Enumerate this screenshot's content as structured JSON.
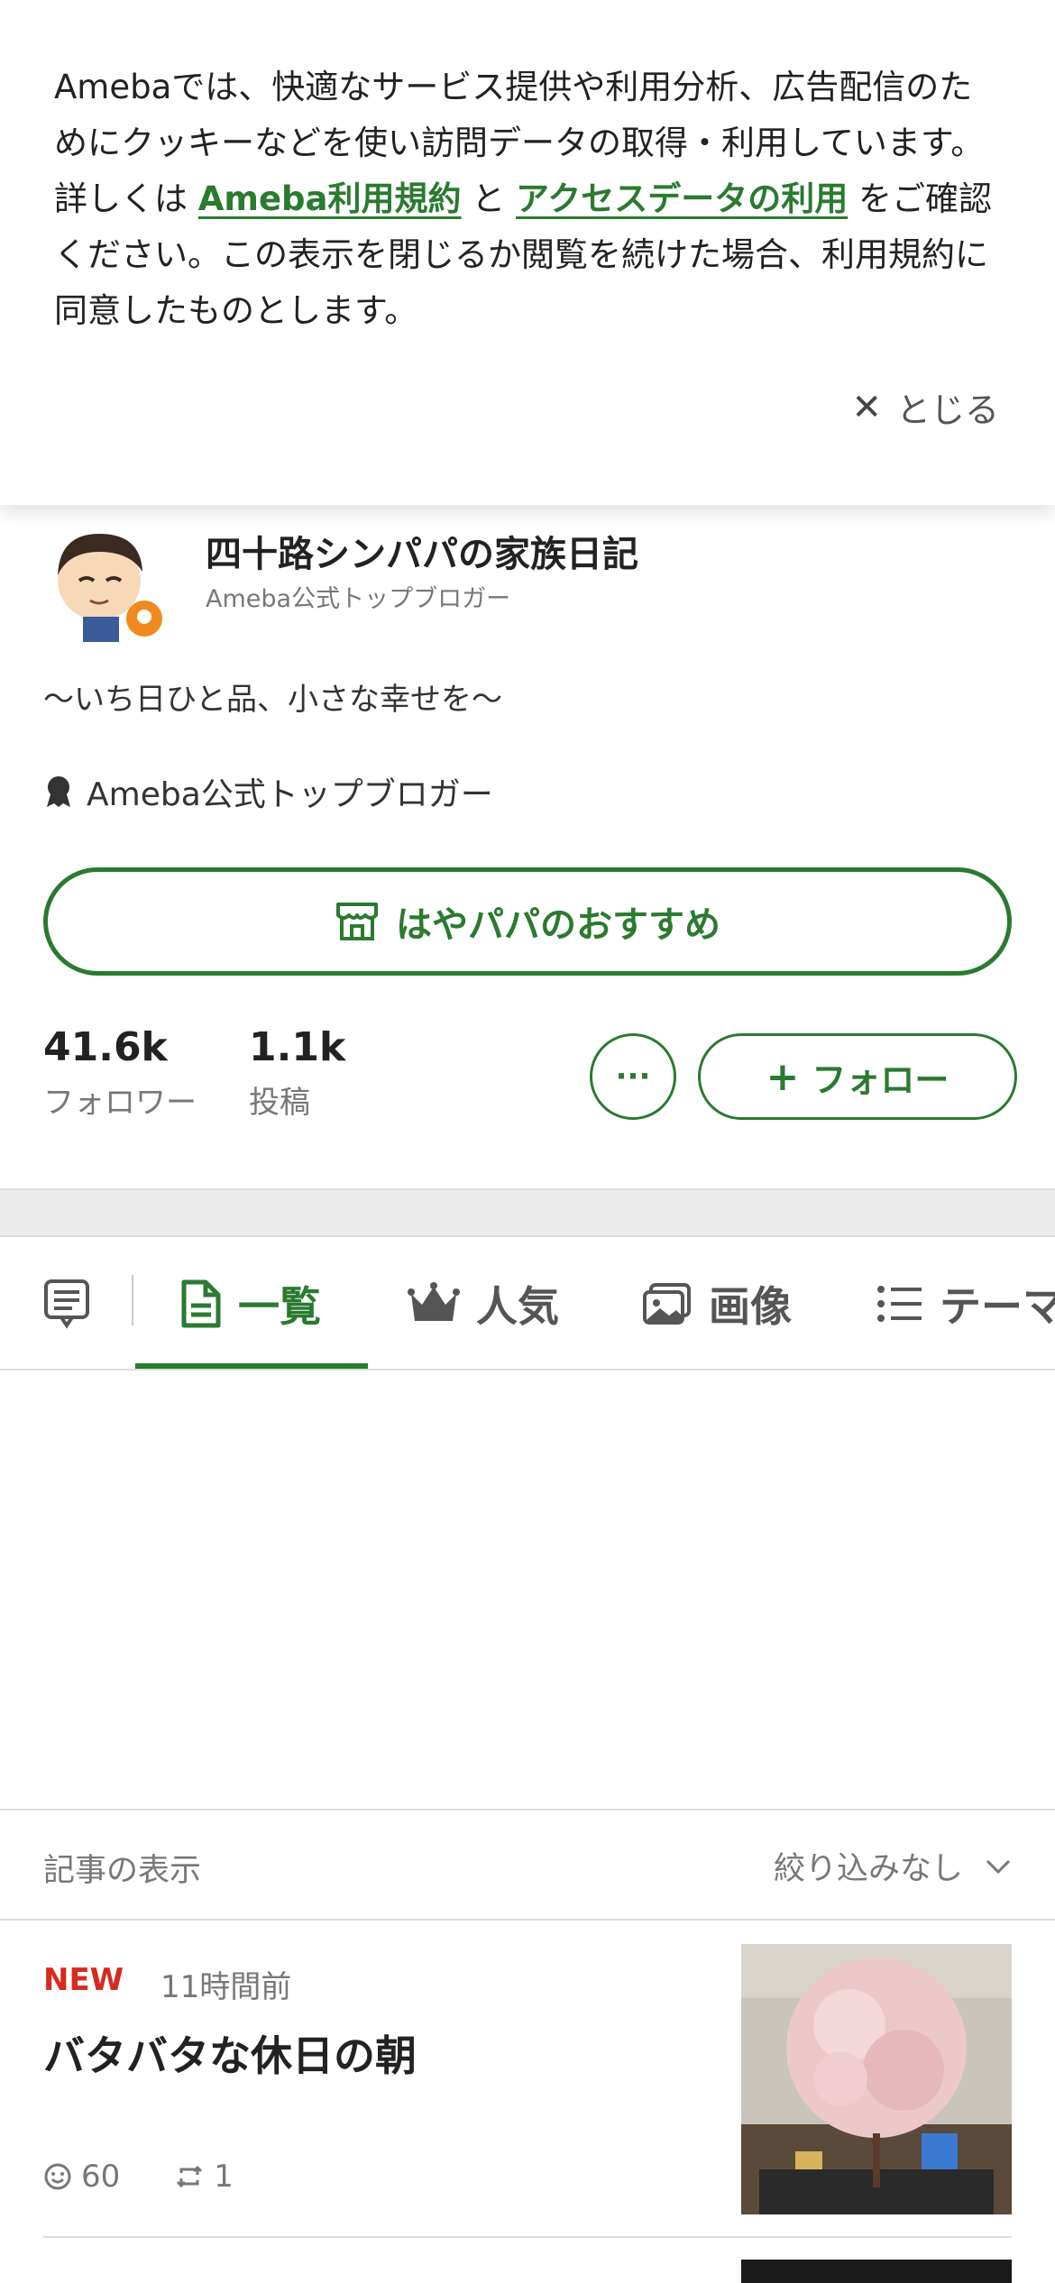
{
  "cookie_banner": {
    "text_1": "Amebaでは、快適なサービス提供や利用分析、広告配信のためにクッキーなどを使い訪問データの取得・利用しています。詳しくは ",
    "link_terms": "Ameba利用規約",
    "text_2": " と ",
    "link_access": "アクセスデータの利用",
    "text_3": " をご確認ください。この表示を閉じるか閲覧を続けた場合、利用規約に同意したものとします。",
    "close_label": "とじる"
  },
  "profile": {
    "blog_title": "四十路シンパパの家族日記",
    "subtitle": "Ameba公式トップブロガー",
    "tagline": "〜いち日ひと品、小さな幸せを〜",
    "badge_text": "Ameba公式トップブロガー",
    "recommend_label": "はやパパのおすすめ",
    "followers_count": "41.6k",
    "followers_label": "フォロワー",
    "posts_count": "1.1k",
    "posts_label": "投稿",
    "more_label": "···",
    "follow_label": "フォロー"
  },
  "tabs": [
    {
      "label": "一覧",
      "icon": "document-icon",
      "active": true
    },
    {
      "label": "人気",
      "icon": "crown-icon",
      "active": false
    },
    {
      "label": "画像",
      "icon": "image-icon",
      "active": false
    },
    {
      "label": "テーマ",
      "icon": "list-icon",
      "active": false
    }
  ],
  "filter": {
    "label": "記事の表示",
    "value": "絞り込みなし"
  },
  "article": {
    "badge": "NEW",
    "time": "11時間前",
    "title": "バタバタな休日の朝",
    "likes": "60",
    "reblogs": "1"
  },
  "colors": {
    "accent": "#2a7a2f",
    "new_badge": "#d62b1f"
  }
}
